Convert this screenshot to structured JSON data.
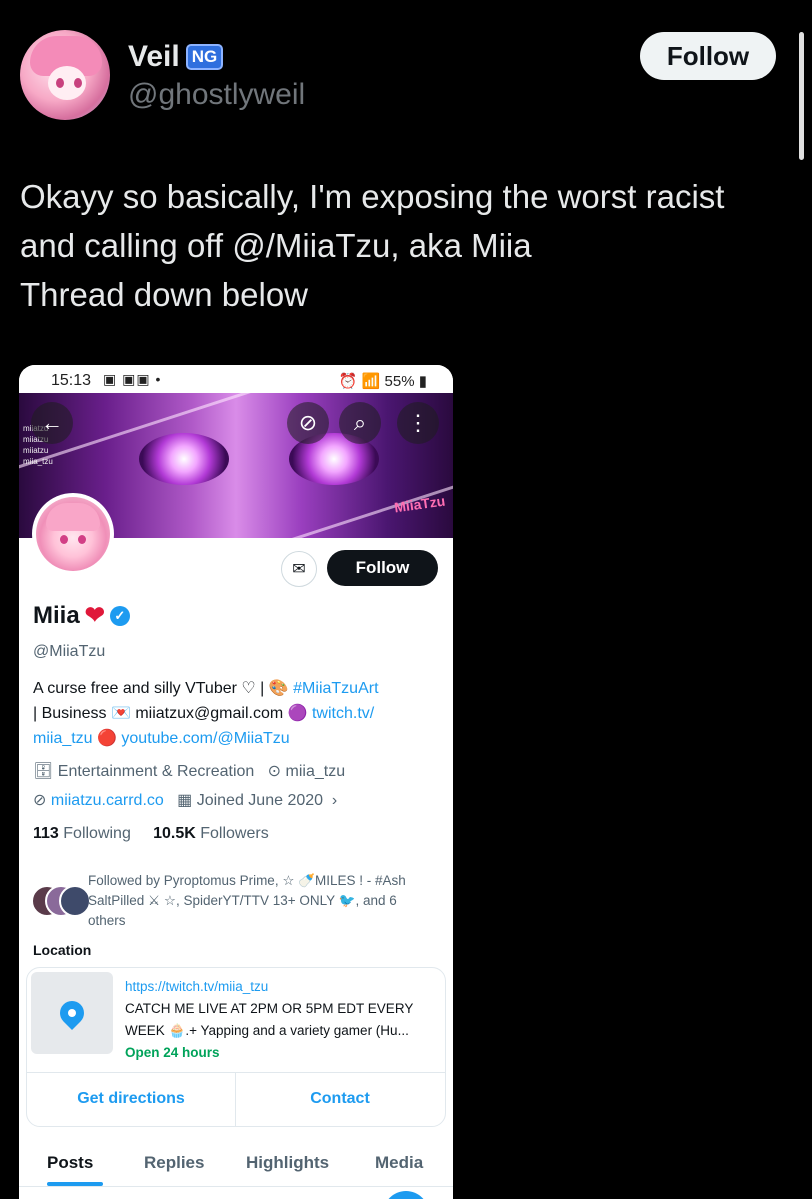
{
  "tweet": {
    "author_name": "Veil",
    "author_badge": "NG",
    "author_handle": "@ghostlyweil",
    "follow_label": "Follow",
    "text_lines": [
      "Okayy so basically, I'm exposing the worst racist",
      "and calling off @/MiiaTzu, aka Miia",
      "Thread down below"
    ]
  },
  "phone": {
    "statusbar": {
      "time": "15:13",
      "left_icons": "▣ ▣▣ •",
      "battery": "55%"
    },
    "banner_watermark": [
      "miiatzu",
      "miiatzu",
      "miiatzu",
      "miia_tzu"
    ],
    "banner_logo": "MiiaTzu",
    "profile": {
      "name": "Miia",
      "handle": "@MiiaTzu",
      "follow_label": "Follow",
      "bio_line1_text": "A curse free and silly VTuber ♡ | 🎨 ",
      "bio_line1_link": "#MiiaTzuArt",
      "bio_line2_text": "| Business 💌 miiatzux@gmail.com 🟣 ",
      "bio_line2_link": "twitch.tv/",
      "bio_line3_link1": "miia_tzu",
      "bio_line3_sep": " 🔴 ",
      "bio_line3_link2": "youtube.com/@MiiaTzu",
      "category": "Entertainment & Recreation",
      "location": "miia_tzu",
      "website": "miiatzu.carrd.co",
      "joined": "Joined June 2020",
      "following_count": "113",
      "following_label": "Following",
      "followers_count": "10.5K",
      "followers_label": "Followers",
      "followed_by": "Followed by Pyroptomus Prime, ☆ 🍼MILES ! - #Ash SaltPilled ⚔ ☆, SpiderYT/TTV 13+ ONLY 🐦, and 6 others"
    },
    "location_card": {
      "section_label": "Location",
      "url": "https://twitch.tv/miia_tzu",
      "desc_line1": "CATCH ME LIVE AT 2PM OR 5PM EDT EVERY",
      "desc_line2": "WEEK 🧁.+ Yapping and a variety gamer (Hu...",
      "hours": "Open 24 hours",
      "directions_label": "Get directions",
      "contact_label": "Contact"
    },
    "tabs": [
      "Posts",
      "Replies",
      "Highlights",
      "Media"
    ]
  }
}
